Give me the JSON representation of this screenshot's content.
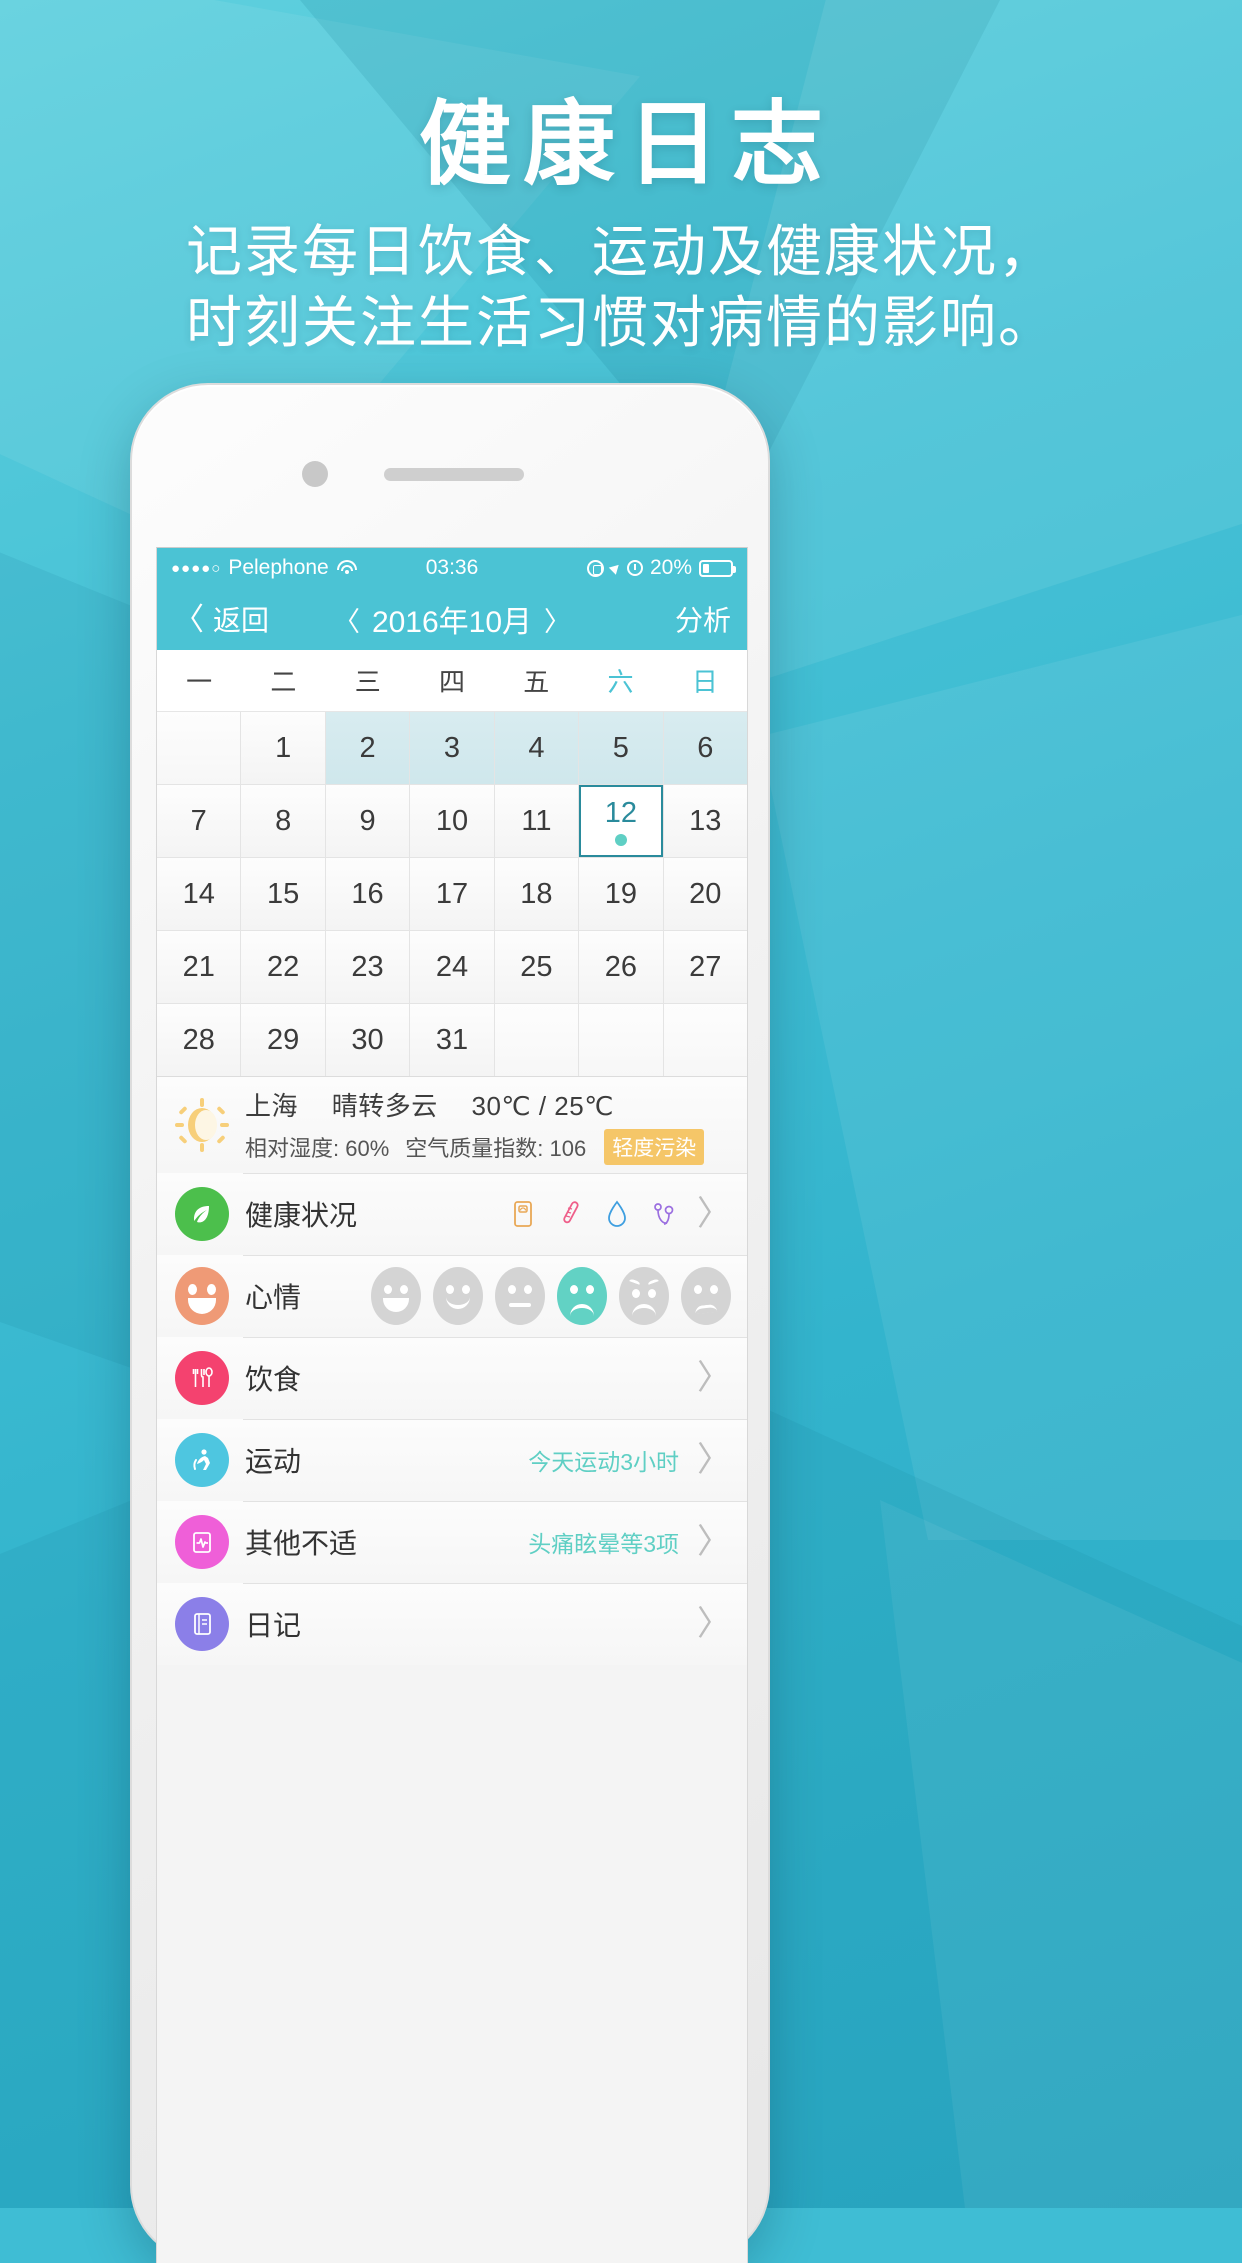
{
  "hero": {
    "title": "健康日志",
    "subtitle_line1": "记录每日饮食、运动及健康状况，",
    "subtitle_line2": "时刻关注生活习惯对病情的影响。"
  },
  "statusbar": {
    "signal_dots": "●●●●○",
    "carrier": "Pelephone",
    "wifi_icon": "wifi-icon",
    "time": "03:36",
    "rotation_lock_icon": "rotation-lock-icon",
    "location_icon": "location-arrow-icon",
    "alarm_icon": "alarm-clock-icon",
    "battery_percent": "20%",
    "battery_icon": "battery-icon"
  },
  "navbar": {
    "back_chevron": "〈",
    "back_label": "返回",
    "prev_chevron": "〈",
    "month_title": "2016年10月",
    "next_chevron": "〉",
    "analysis_label": "分析"
  },
  "calendar": {
    "weekdays": [
      {
        "label": "一",
        "weekend": false
      },
      {
        "label": "二",
        "weekend": false
      },
      {
        "label": "三",
        "weekend": false
      },
      {
        "label": "四",
        "weekend": false
      },
      {
        "label": "五",
        "weekend": false
      },
      {
        "label": "六",
        "weekend": true
      },
      {
        "label": "日",
        "weekend": true
      }
    ],
    "selected_day": 12,
    "dot_color": "#5fcfc4",
    "selected_border_color": "#2a8b9c",
    "tinted_color": "#d2e8ed",
    "cells": [
      {
        "label": "",
        "state": "empty"
      },
      {
        "label": "1",
        "state": "normal"
      },
      {
        "label": "2",
        "state": "tinted"
      },
      {
        "label": "3",
        "state": "tinted"
      },
      {
        "label": "4",
        "state": "tinted"
      },
      {
        "label": "5",
        "state": "tinted"
      },
      {
        "label": "6",
        "state": "tinted"
      },
      {
        "label": "7",
        "state": "normal"
      },
      {
        "label": "8",
        "state": "normal"
      },
      {
        "label": "9",
        "state": "normal"
      },
      {
        "label": "10",
        "state": "normal"
      },
      {
        "label": "11",
        "state": "normal"
      },
      {
        "label": "12",
        "state": "selected"
      },
      {
        "label": "13",
        "state": "normal"
      },
      {
        "label": "14",
        "state": "normal"
      },
      {
        "label": "15",
        "state": "normal"
      },
      {
        "label": "16",
        "state": "normal"
      },
      {
        "label": "17",
        "state": "normal"
      },
      {
        "label": "18",
        "state": "normal"
      },
      {
        "label": "19",
        "state": "normal"
      },
      {
        "label": "20",
        "state": "normal"
      },
      {
        "label": "21",
        "state": "normal"
      },
      {
        "label": "22",
        "state": "normal"
      },
      {
        "label": "23",
        "state": "normal"
      },
      {
        "label": "24",
        "state": "normal"
      },
      {
        "label": "25",
        "state": "normal"
      },
      {
        "label": "26",
        "state": "normal"
      },
      {
        "label": "27",
        "state": "normal"
      },
      {
        "label": "28",
        "state": "normal"
      },
      {
        "label": "29",
        "state": "normal"
      },
      {
        "label": "30",
        "state": "normal"
      },
      {
        "label": "31",
        "state": "normal"
      },
      {
        "label": "",
        "state": "empty"
      },
      {
        "label": "",
        "state": "empty"
      },
      {
        "label": "",
        "state": "empty"
      }
    ]
  },
  "weather": {
    "icon": "sun-behind-cloud-icon",
    "city": "上海",
    "condition": "晴转多云",
    "temperature": "30℃ / 25℃",
    "humidity": "相对湿度: 60%",
    "aqi": "空气质量指数: 106",
    "aqi_badge": "轻度污染",
    "badge_color": "#f5c668"
  },
  "rows": {
    "health": {
      "icon": "leaf-icon",
      "icon_color": "#4cbf4c",
      "label": "健康状况",
      "metrics": [
        {
          "name": "weight-scale-icon",
          "color": "#e9a856"
        },
        {
          "name": "thermometer-icon",
          "color": "#ef5f8a"
        },
        {
          "name": "water-drop-icon",
          "color": "#3f9fe0"
        },
        {
          "name": "stethoscope-icon",
          "color": "#9b6fe0"
        }
      ],
      "chevron": "〉"
    },
    "mood": {
      "icon": "smiley-face-icon",
      "icon_color": "#ef9a76",
      "label": "心情",
      "selected_index": 3,
      "selected_color": "#62d2c4",
      "options": [
        "mood-laugh-icon",
        "mood-smile-icon",
        "mood-neutral-icon",
        "mood-sad-icon",
        "mood-worried-icon",
        "mood-upset-icon"
      ]
    },
    "diet": {
      "icon": "cutlery-icon",
      "icon_color": "#f4426f",
      "label": "饮食",
      "value": "",
      "chevron": "〉"
    },
    "exercise": {
      "icon": "runner-icon",
      "icon_color": "#4ec6e0",
      "label": "运动",
      "value": "今天运动3小时",
      "chevron": "〉"
    },
    "discomfort": {
      "icon": "heart-monitor-icon",
      "icon_color": "#ef5fd8",
      "label": "其他不适",
      "value": "头痛眩晕等3项",
      "chevron": "〉"
    },
    "diary": {
      "icon": "notebook-icon",
      "icon_color": "#8b7fe8",
      "label": "日记",
      "value": "",
      "chevron": "〉"
    }
  }
}
